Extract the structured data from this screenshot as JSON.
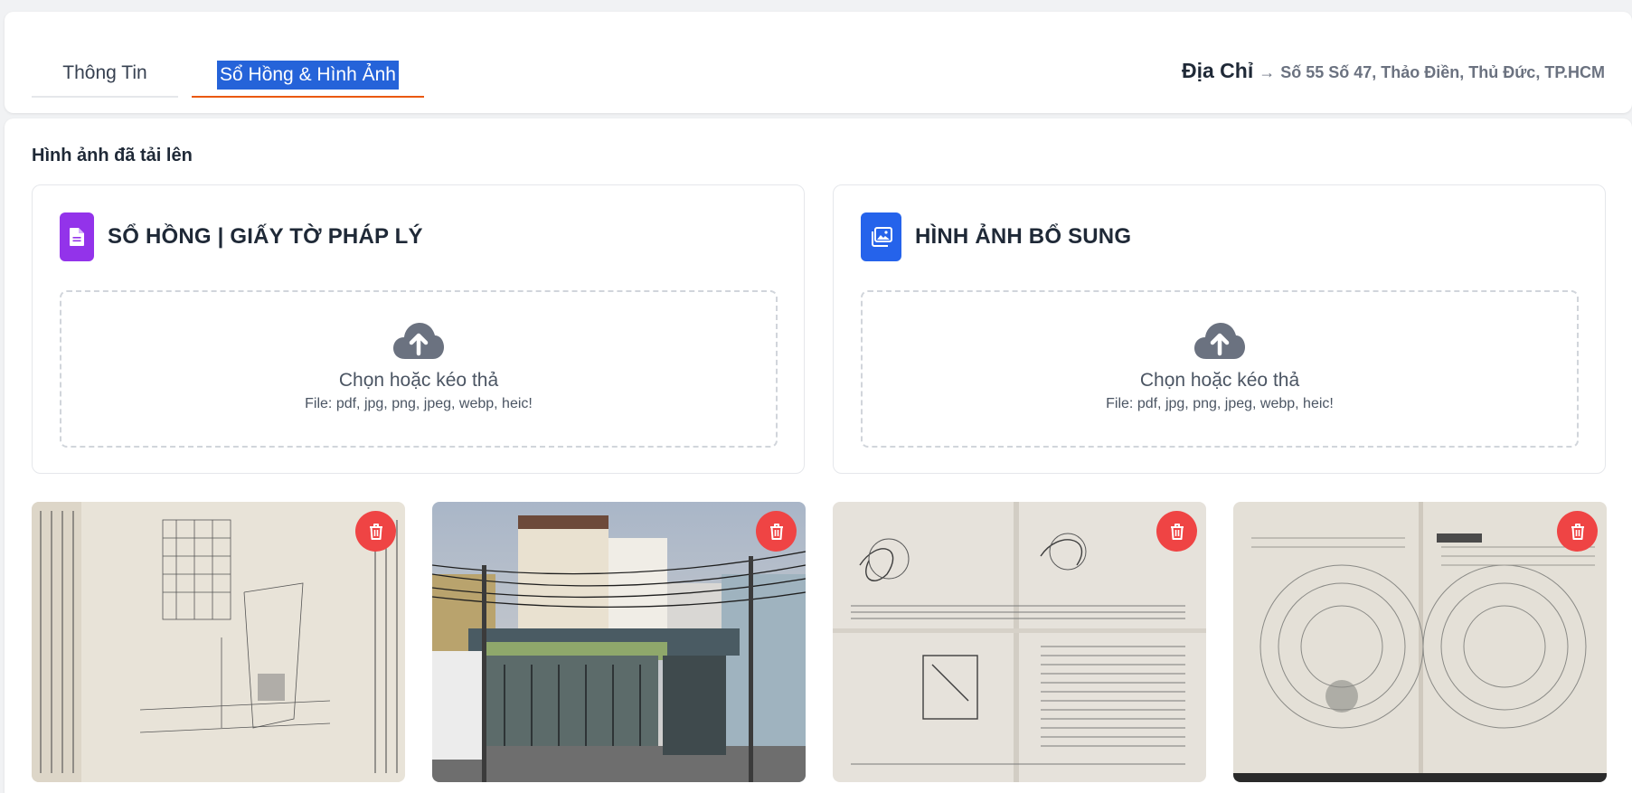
{
  "tabs": [
    {
      "label": "Thông Tin"
    },
    {
      "label": "Sổ Hồng & Hình Ảnh"
    }
  ],
  "address": {
    "label": "Địa Chỉ",
    "arrow": "→",
    "value": "Số 55 Số 47, Thảo Điền, Thủ Đức, TP.HCM"
  },
  "section_title": "Hình ảnh đã tải lên",
  "panels": [
    {
      "title": "SỔ HỒNG | GIẤY TỜ PHÁP LÝ",
      "icon": "document-icon",
      "color": "#9333ea"
    },
    {
      "title": "HÌNH ẢNH BỔ SUNG",
      "icon": "image-gallery-icon",
      "color": "#2563eb"
    }
  ],
  "dropzone": {
    "main": "Chọn hoặc kéo thả",
    "sub": "File: pdf, jpg, png, jpeg, webp, heic!"
  },
  "thumbnails": [
    {
      "kind": "land-plan-scan"
    },
    {
      "kind": "house-front-photo"
    },
    {
      "kind": "certificate-scan"
    },
    {
      "kind": "certificate-cover-scan"
    }
  ],
  "colors": {
    "accent_tab": "#ea580c",
    "selection": "#2563d9",
    "delete": "#ef4444"
  }
}
